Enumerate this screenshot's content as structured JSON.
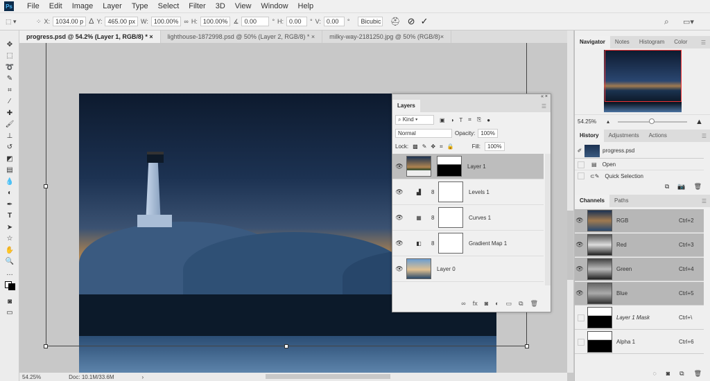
{
  "app": {
    "logo": "Ps",
    "menu": [
      "File",
      "Edit",
      "Image",
      "Layer",
      "Type",
      "Select",
      "Filter",
      "3D",
      "View",
      "Window",
      "Help"
    ]
  },
  "options": {
    "x_label": "X:",
    "x": "1034.00 p",
    "y_label": "Y:",
    "y": "465.00 px",
    "w_label": "W:",
    "w": "100.00%",
    "h_label": "H:",
    "h": "100.00%",
    "angle": "0.00",
    "hskew_label": "H:",
    "hskew": "0.00",
    "vskew_label": "V:",
    "vskew": "0.00",
    "degree": "°",
    "interp": "Bicubic"
  },
  "tabs": [
    {
      "label": "progress.psd @ 54.2% (Layer 1, RGB/8) *"
    },
    {
      "label": "lighthouse-1872998.psd @ 50% (Layer 2, RGB/8) *"
    },
    {
      "label": "milky-way-2181250.jpg @ 50% (RGB/8)"
    }
  ],
  "status": {
    "zoom": "54.25%",
    "doc": "Doc: 10.1M/33.6M"
  },
  "layers": {
    "tab": "Layers",
    "filter": "Kind",
    "blend": "Normal",
    "opacity_label": "Opacity:",
    "opacity": "100%",
    "lock_label": "Lock:",
    "fill_label": "Fill:",
    "fill": "100%",
    "items": [
      {
        "name": "Layer 1"
      },
      {
        "name": "Levels 1"
      },
      {
        "name": "Curves 1"
      },
      {
        "name": "Gradient Map 1"
      },
      {
        "name": "Layer 0"
      }
    ]
  },
  "navigator": {
    "tabs": [
      "Navigator",
      "Notes",
      "Histogram",
      "Color"
    ],
    "zoom": "54.25%"
  },
  "history": {
    "tabs": [
      "History",
      "Adjustments",
      "Actions"
    ],
    "snapshot": "progress.psd",
    "items": [
      "Open",
      "Quick Selection"
    ]
  },
  "channels": {
    "tabs": [
      "Channels",
      "Paths"
    ],
    "items": [
      {
        "name": "RGB",
        "shortcut": "Ctrl+2"
      },
      {
        "name": "Red",
        "shortcut": "Ctrl+3"
      },
      {
        "name": "Green",
        "shortcut": "Ctrl+4"
      },
      {
        "name": "Blue",
        "shortcut": "Ctrl+5"
      },
      {
        "name": "Layer 1 Mask",
        "shortcut": "Ctrl+\\"
      },
      {
        "name": "Alpha 1",
        "shortcut": "Ctrl+6"
      }
    ]
  }
}
